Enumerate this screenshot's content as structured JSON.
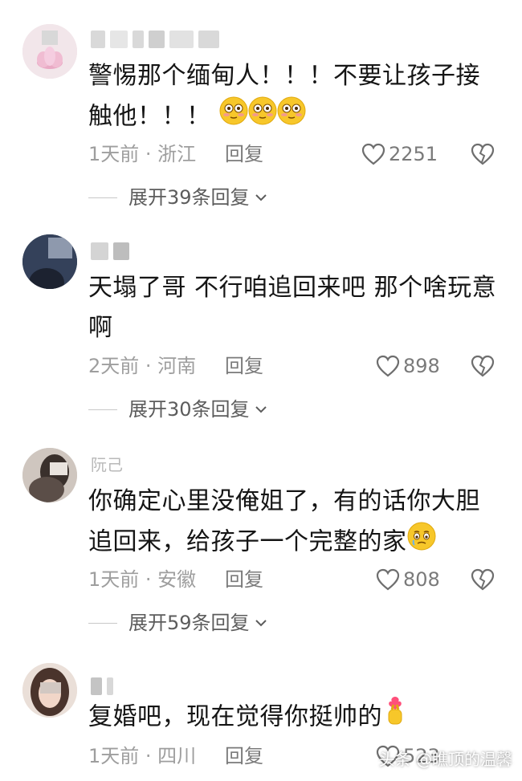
{
  "comments": [
    {
      "text_line1": "警惕那个缅甸人！！！不要让孩子接",
      "text_line2": "触他！！！",
      "time_location": "1天前 · 浙江",
      "reply_label": "回复",
      "likes": "2251",
      "expand_label": "展开39条回复",
      "emoji": [
        "flushed-face",
        "flushed-face",
        "flushed-face"
      ]
    },
    {
      "text_line1": "天塌了哥 不行咱追回来吧 那个啥玩意",
      "text_line2": "啊",
      "time_location": "2天前 · 河南",
      "reply_label": "回复",
      "likes": "898",
      "expand_label": "展开30条回复"
    },
    {
      "username": "阮己",
      "text_line1": "你确定心里没俺姐了，有的话你大胆",
      "text_line2": "追回来，给孩子一个完整的家",
      "time_location": "1天前 · 安徽",
      "reply_label": "回复",
      "likes": "808",
      "expand_label": "展开59条回复",
      "emoji": [
        "holding-back-tears-face"
      ]
    },
    {
      "text_line1": "复婚吧，现在觉得你挺帅的",
      "time_location": "1天前 · 四川",
      "reply_label": "回复",
      "likes": "523",
      "emoji": [
        "finger-heart"
      ]
    }
  ],
  "watermark": "头条 @瞧顶的温馨",
  "colors": {
    "text": "#151515",
    "meta": "#9e9e9e",
    "emoji_yellow": "#f7c72a"
  }
}
